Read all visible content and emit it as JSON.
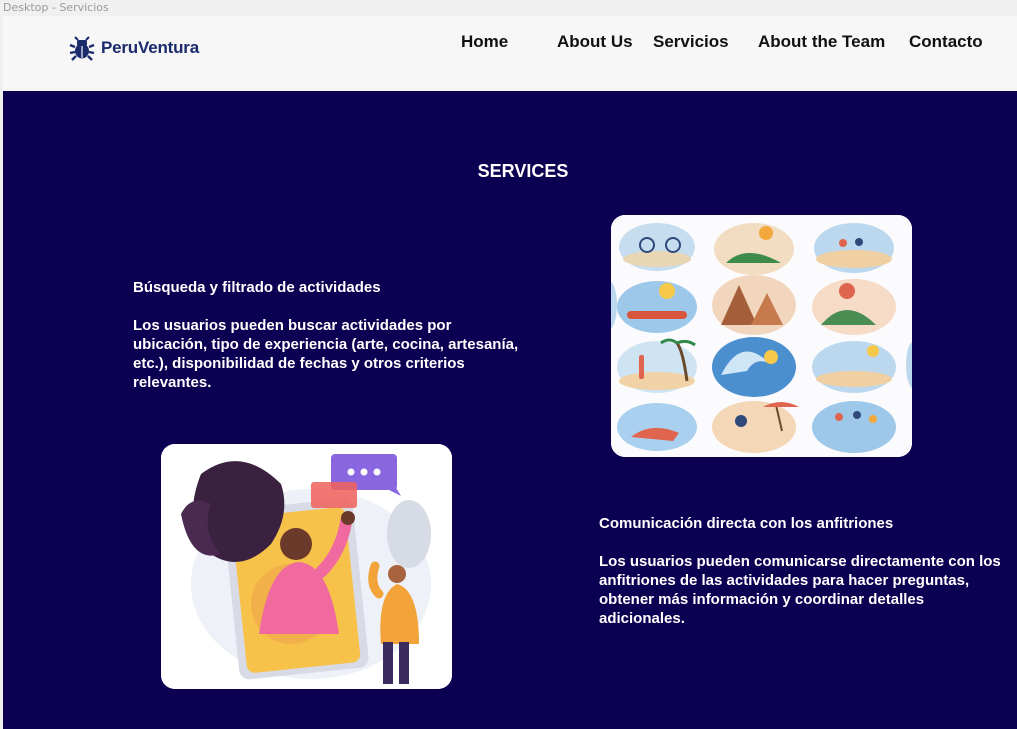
{
  "frame_label": "Desktop - Servicios",
  "brand": {
    "name": "PeruVentura",
    "icon": "bug-logo-icon",
    "color": "#1b2a6b"
  },
  "nav": {
    "items": [
      {
        "label": "Home"
      },
      {
        "label": "About Us"
      },
      {
        "label": "Servicios"
      },
      {
        "label": "About the Team"
      },
      {
        "label": "Contacto"
      }
    ]
  },
  "section": {
    "title": "SERVICES",
    "background": "#0b0051"
  },
  "features": [
    {
      "title": "Búsqueda y filtrado de actividades",
      "description": "Los usuarios pueden buscar actividades por ubicación, tipo de experiencia (arte, cocina, artesanía, etc.), disponibilidad de fechas y otros criterios relevantes."
    },
    {
      "title": "Comunicación directa con los anfitriones",
      "description": "Los usuarios pueden comunicarse directamente con los anfitriones de las actividades para hacer preguntas, obtener más información y coordinar detalles adicionales."
    }
  ],
  "images": {
    "activities": "activities-collage-illustration",
    "chat": "video-chat-illustration"
  }
}
